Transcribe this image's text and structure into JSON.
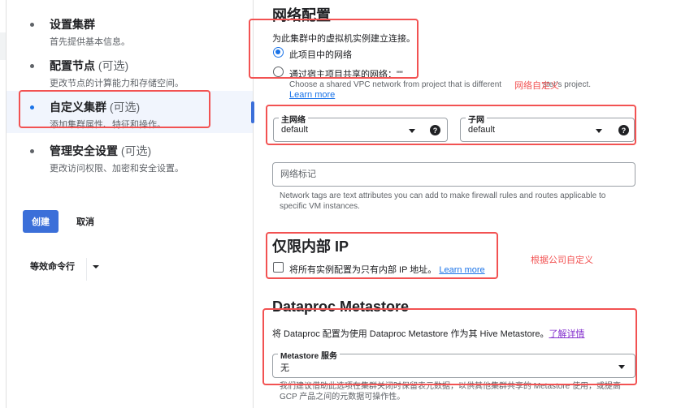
{
  "sidebar": {
    "steps": [
      {
        "title": "设置集群",
        "optional": "",
        "desc": "首先提供基本信息。",
        "active": false
      },
      {
        "title": "配置节点",
        "optional": "(可选)",
        "desc": "更改节点的计算能力和存储空间。",
        "active": false
      },
      {
        "title": "自定义集群",
        "optional": "(可选)",
        "desc": "添加集群属性、特征和操作。",
        "active": true
      },
      {
        "title": "管理安全设置",
        "optional": "(可选)",
        "desc": "更改访问权限、加密和安全设置。",
        "active": false
      }
    ],
    "create_label": "创建",
    "cancel_label": "取消",
    "command_line_label": "等效命令行"
  },
  "network": {
    "heading": "网络配置",
    "intro": "为此集群中的虚拟机实例建立连接。",
    "radio_options": [
      {
        "label": "此项目中的网络",
        "selected": true
      },
      {
        "label": "通过宿主项目共享的网络：\"\"",
        "selected": false
      }
    ],
    "shared_hint_before": "Choose a shared VPC network from project that is different ",
    "shared_hint_after": "ster's project.",
    "learn_more": "Learn more",
    "annotation": "网络自定义",
    "primary_network": {
      "label": "主网络",
      "value": "default"
    },
    "subnet": {
      "label": "子网",
      "value": "default"
    },
    "tags_placeholder": "网络标记",
    "tags_hint": "Network tags are text attributes you can add to make firewall rules and routes applicable to specific VM instances."
  },
  "internal_ip": {
    "heading": "仅限内部 IP",
    "checkbox_label": "将所有实例配置为只有内部 IP 地址。",
    "checked": false,
    "learn_more": "Learn more",
    "annotation": "根据公司自定义"
  },
  "metastore": {
    "heading": "Dataproc Metastore",
    "intro": "将 Dataproc 配置为使用 Dataproc Metastore 作为其 Hive Metastore。",
    "learn_more": "了解详情",
    "service": {
      "label": "Metastore 服务",
      "value": "无"
    },
    "hint": "我们建议借助此选项在集群关闭时保留表元数据，以供其他集群共享的 Metastore 使用，或提高 GCP 产品之间的元数据可操作性。"
  },
  "colors": {
    "accent": "#1a73e8",
    "primary_button": "#3b6fd9",
    "annotation_red": "#f25252",
    "visited_link": "#8430ce"
  }
}
